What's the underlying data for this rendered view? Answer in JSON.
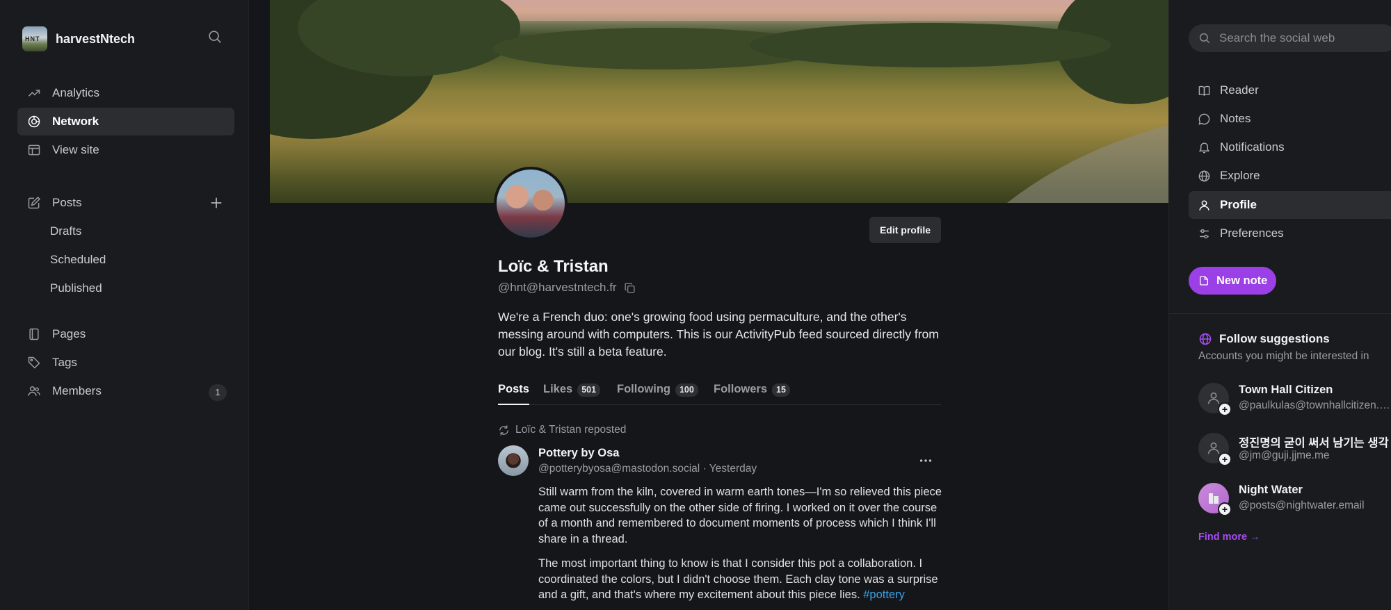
{
  "site": {
    "name": "harvestNtech",
    "logo_text": "HNT"
  },
  "left_nav": {
    "items": [
      {
        "label": "Analytics",
        "icon": "trending-up-icon"
      },
      {
        "label": "Network",
        "icon": "network-icon",
        "active": true
      },
      {
        "label": "View site",
        "icon": "layout-icon"
      }
    ],
    "posts": {
      "label": "Posts",
      "icon": "edit-icon",
      "sub": [
        "Drafts",
        "Scheduled",
        "Published"
      ]
    },
    "more": [
      {
        "label": "Pages",
        "icon": "page-icon"
      },
      {
        "label": "Tags",
        "icon": "tag-icon"
      },
      {
        "label": "Members",
        "icon": "members-icon",
        "count": "1"
      }
    ]
  },
  "profile": {
    "name": "Loïc & Tristan",
    "handle": "@hnt@harvestntech.fr",
    "bio": "We're a French duo: one's growing food using permaculture, and the other's messing around with computers. This is our ActivityPub feed sourced directly from our blog. It's still a beta feature.",
    "edit_label": "Edit profile"
  },
  "tabs": [
    {
      "label": "Posts",
      "count": null,
      "active": true
    },
    {
      "label": "Likes",
      "count": "501"
    },
    {
      "label": "Following",
      "count": "100"
    },
    {
      "label": "Followers",
      "count": "15"
    }
  ],
  "post": {
    "repost_text": "Loïc & Tristan reposted",
    "author": "Pottery by Osa",
    "handle": "@potterybyosa@mastodon.social",
    "time": "Yesterday",
    "meta_sep": " · ",
    "para1": "Still warm from the kiln, covered in warm earth tones—I'm so relieved this piece came out successfully on the other side of firing. I worked on it over the course of a month and remembered to document moments of process which I think I'll share in a thread.",
    "para2": "The most important thing to know is that I consider this pot a collaboration. I coordinated the colors, but I didn't choose them. Each clay tone was a surprise and a gift, and that's where my excitement about this piece lies.",
    "hashtag": "#pottery"
  },
  "right": {
    "search_placeholder": "Search the social web",
    "nav": [
      {
        "label": "Reader",
        "icon": "book-icon"
      },
      {
        "label": "Notes",
        "icon": "chat-icon"
      },
      {
        "label": "Notifications",
        "icon": "bell-icon"
      },
      {
        "label": "Explore",
        "icon": "globe-icon"
      },
      {
        "label": "Profile",
        "icon": "user-icon",
        "active": true
      },
      {
        "label": "Preferences",
        "icon": "sliders-icon"
      }
    ],
    "new_note": "New note",
    "follow": {
      "title": "Follow suggestions",
      "subtitle": "Accounts you might be interested in",
      "suggestions": [
        {
          "name": "Town Hall Citizen",
          "handle": "@paulkulas@townhallcitizen.social"
        },
        {
          "name": "정진명의 굳이 써서 남기는 생각",
          "handle": "@jm@guji.jjme.me"
        },
        {
          "name": "Night Water",
          "handle": "@posts@nightwater.email"
        }
      ],
      "find_more": "Find more →"
    }
  },
  "colors": {
    "accent": "#9b3fe6",
    "link": "#3aa3e8",
    "bg": "#151619",
    "sidebar": "#1a1b1e"
  }
}
